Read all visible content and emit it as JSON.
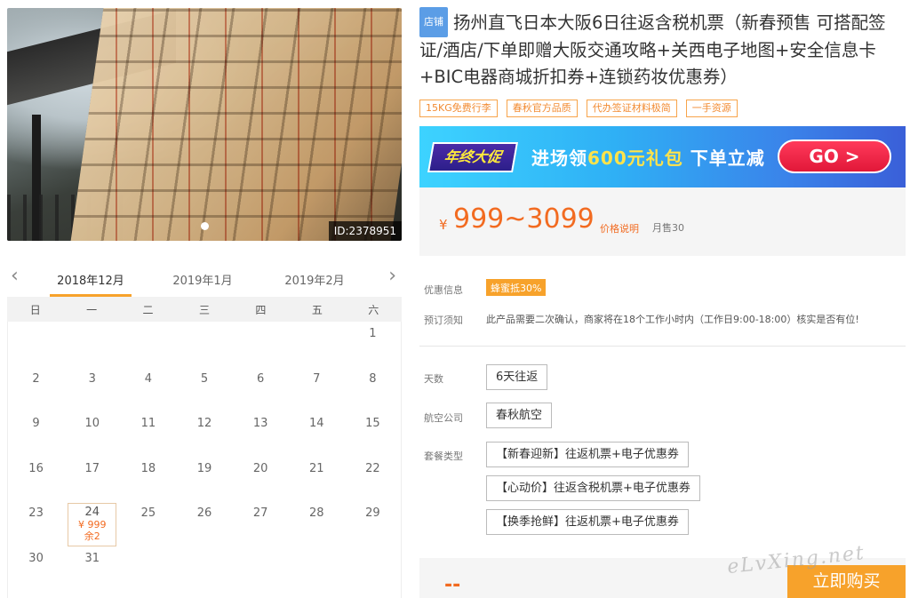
{
  "gallery": {
    "image_id": "ID:2378951"
  },
  "calendar": {
    "months": [
      "2018年12月",
      "2019年1月",
      "2019年2月"
    ],
    "weekdays": [
      "日",
      "一",
      "二",
      "三",
      "四",
      "五",
      "六"
    ],
    "days": [
      "",
      "",
      "",
      "",
      "",
      "",
      "1",
      "2",
      "3",
      "4",
      "5",
      "6",
      "7",
      "8",
      "9",
      "10",
      "11",
      "12",
      "13",
      "14",
      "15",
      "16",
      "17",
      "18",
      "19",
      "20",
      "21",
      "22",
      "23",
      "24",
      "25",
      "26",
      "27",
      "28",
      "29",
      "30",
      "31",
      "",
      "",
      "",
      "",
      ""
    ],
    "priced_day": {
      "day": "24",
      "price": "¥ 999",
      "stock": "余2"
    }
  },
  "product": {
    "shop_tag": "店铺",
    "title": "扬州直飞日本大阪6日往返含税机票（新春预售 可搭配签证/酒店/下单即赠大阪交通攻略+关西电子地图+安全信息卡+BIC电器商城折扣券+连锁药妆优惠券）",
    "tags": [
      "15KG免费行李",
      "春秋官方品质",
      "代办签证材料极简",
      "一手资源"
    ]
  },
  "banner": {
    "badge": "年终大促",
    "msg_pre": "进场领",
    "msg_amount": "600元礼包",
    "msg_post": " 下单立减",
    "go": "GO >"
  },
  "price": {
    "currency": "¥",
    "value": "999~3099",
    "explain": "价格说明",
    "sold": "月售30"
  },
  "info": {
    "promo_label": "优惠信息",
    "promo_badge": "蜂蜜抵30%",
    "notice_label": "预订须知",
    "notice": "此产品需要二次确认，商家将在18个工作小时内（工作日9:00-18:00）核实是否有位!"
  },
  "options": {
    "days_label": "天数",
    "days": "6天往返",
    "airline_label": "航空公司",
    "airline": "春秋航空",
    "package_label": "套餐类型",
    "packages": [
      "【新春迎新】往返机票+电子优惠券",
      "【心动价】往返含税机票+电子优惠券",
      "【换季抢鲜】往返机票+电子优惠券"
    ]
  },
  "buy": {
    "dash": "--",
    "button": "立即购买"
  },
  "watermark": "eLvXing.net"
}
